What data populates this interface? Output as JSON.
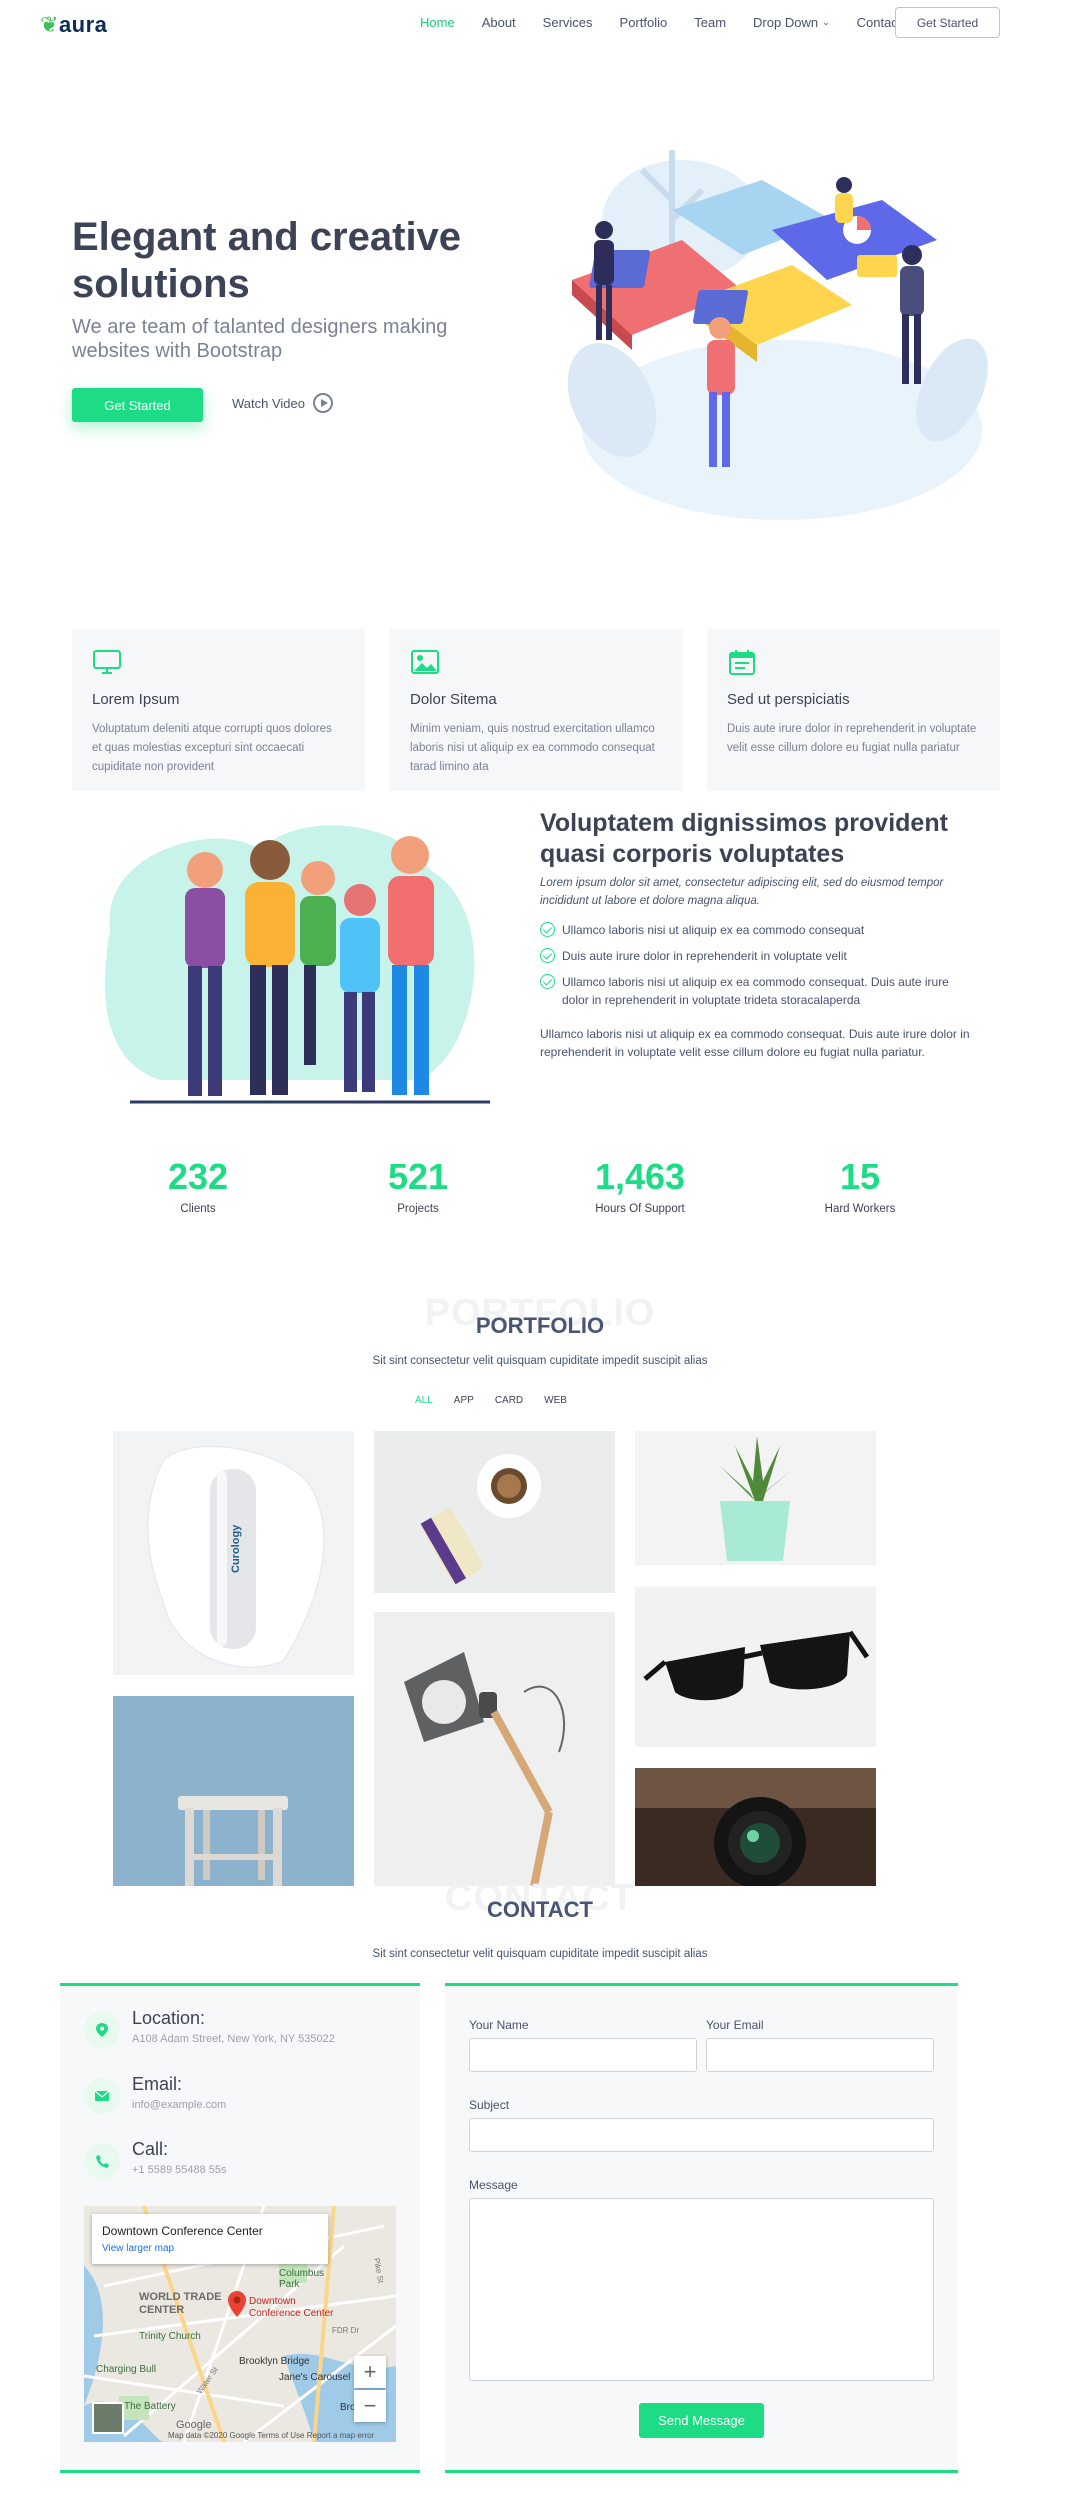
{
  "brand": {
    "logo": "aura"
  },
  "nav": {
    "items": [
      "Home",
      "About",
      "Services",
      "Portfolio",
      "Team",
      "Drop Down",
      "Contact"
    ],
    "active": "Home",
    "cta": "Get Started"
  },
  "hero": {
    "title": "Elegant and creative solutions",
    "subtitle": "We are team of talanted designers making websites with Bootstrap",
    "primary_button": "Get Started",
    "watch_video": "Watch Video"
  },
  "features": [
    {
      "icon": "monitor-icon",
      "title": "Lorem Ipsum",
      "desc": "Voluptatum deleniti atque corrupti quos dolores et quas molestias excepturi sint occaecati cupiditate non provident"
    },
    {
      "icon": "image-icon",
      "title": "Dolor Sitema",
      "desc": "Minim veniam, quis nostrud exercitation ullamco laboris nisi ut aliquip ex ea commodo consequat tarad limino ata"
    },
    {
      "icon": "calendar-icon",
      "title": "Sed ut perspiciatis",
      "desc": "Duis aute irure dolor in reprehenderit in voluptate velit esse cillum dolore eu fugiat nulla pariatur"
    }
  ],
  "about": {
    "title": "Voluptatem dignissimos provident quasi corporis voluptates",
    "italic": "Lorem ipsum dolor sit amet, consectetur adipiscing elit, sed do eiusmod tempor incididunt ut labore et dolore magna aliqua.",
    "checks": [
      "Ullamco laboris nisi ut aliquip ex ea commodo consequat",
      "Duis aute irure dolor in reprehenderit in voluptate velit",
      "Ullamco laboris nisi ut aliquip ex ea commodo consequat. Duis aute irure dolor in reprehenderit in voluptate trideta storacalaperda"
    ],
    "paragraph": "Ullamco laboris nisi ut aliquip ex ea commodo consequat. Duis aute irure dolor in reprehenderit in voluptate velit esse cillum dolore eu fugiat nulla pariatur."
  },
  "counts": [
    {
      "num": "232",
      "label": "Clients"
    },
    {
      "num": "521",
      "label": "Projects"
    },
    {
      "num": "1,463",
      "label": "Hours Of Support"
    },
    {
      "num": "15",
      "label": "Hard Workers"
    }
  ],
  "portfolio": {
    "ghost": "PORTFOLIO",
    "title": "PORTFOLIO",
    "subtitle": "Sit sint consectetur velit quisquam cupiditate impedit suscipit alias",
    "filters": [
      "ALL",
      "APP",
      "CARD",
      "WEB"
    ],
    "active_filter": "ALL",
    "bottle_label": "Curology"
  },
  "contact": {
    "ghost": "CONTACT",
    "title": "CONTACT",
    "subtitle": "Sit sint consectetur velit quisquam cupiditate impedit suscipit alias",
    "location_title": "Location:",
    "location": "A108 Adam Street, New York, NY 535022",
    "email_title": "Email:",
    "email": "info@example.com",
    "call_title": "Call:",
    "phone": "+1 5589 55488 55s",
    "map": {
      "place": "Downtown Conference Center",
      "link": "View larger map",
      "pin_label": "Downtown Conference Center",
      "labels": [
        "Columbus Park",
        "WORLD TRADE CENTER",
        "Trinity Church",
        "Charging Bull",
        "Brooklyn Bridge",
        "Jane's Carousel",
        "The Battery",
        "Pike St",
        "Water St",
        "FDR Dr",
        "Broo"
      ],
      "footer": "Map data ©2020 Google   Terms of Use   Report a map error",
      "google": "Google"
    },
    "form": {
      "name_label": "Your Name",
      "email_label": "Your Email",
      "subject_label": "Subject",
      "message_label": "Message",
      "send": "Send Message"
    }
  }
}
